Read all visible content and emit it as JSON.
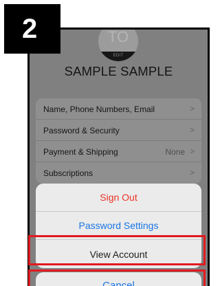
{
  "step": {
    "number": "2"
  },
  "profile": {
    "initials": "TO",
    "edit_label": "EDIT",
    "name": "SAMPLE SAMPLE"
  },
  "settings": {
    "rows": [
      {
        "label": "Name, Phone Numbers, Email",
        "value": "",
        "chevron": ">"
      },
      {
        "label": "Password & Security",
        "value": "",
        "chevron": ">"
      },
      {
        "label": "Payment & Shipping",
        "value": "None",
        "chevron": ">"
      },
      {
        "label": "Subscriptions",
        "value": "",
        "chevron": ">"
      }
    ]
  },
  "action_sheet": {
    "sign_out": "Sign Out",
    "password_settings": "Password Settings",
    "view_account": "View Account",
    "cancel": "Cancel"
  },
  "colors": {
    "destructive": "#ea3326",
    "link": "#1975e6",
    "highlight": "#e11a1f"
  }
}
